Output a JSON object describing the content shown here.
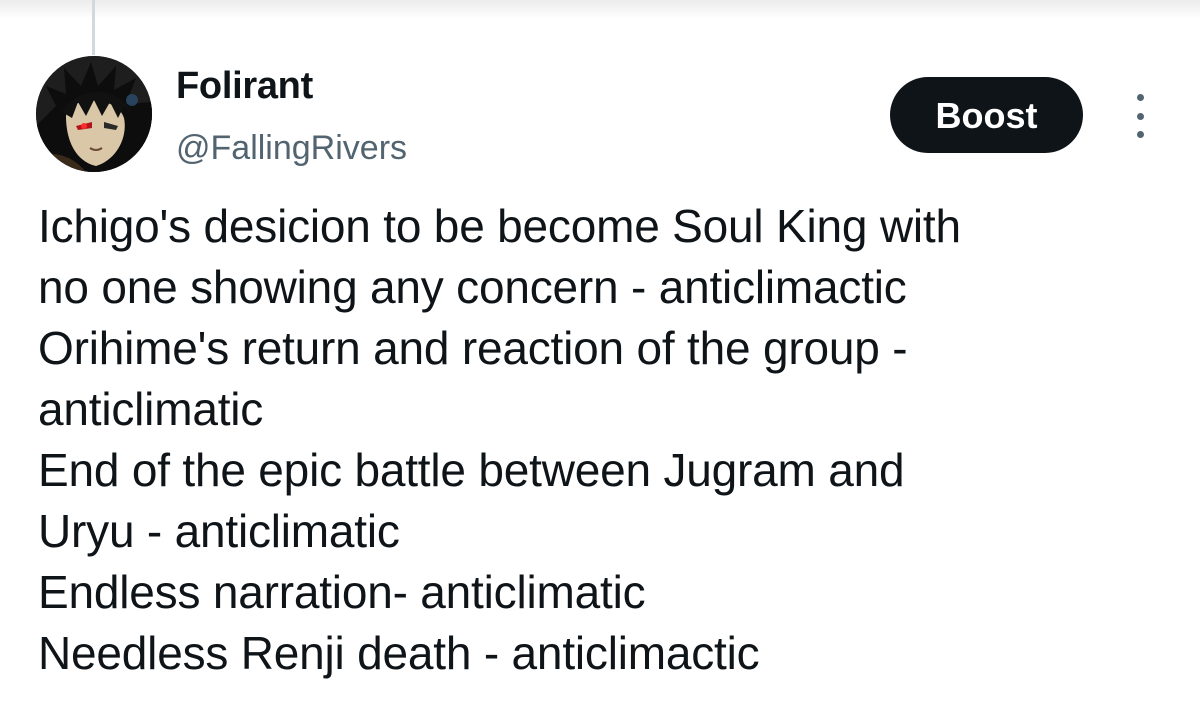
{
  "author": {
    "display_name": "Folirant",
    "handle": "@FallingRivers",
    "avatar_icon": "anime-character-avatar"
  },
  "actions": {
    "boost_label": "Boost",
    "more_icon": "vertical-ellipsis-icon"
  },
  "post": {
    "lines": [
      "Ichigo's desicion to be become Soul King with",
      "no one showing any concern - anticlimactic",
      "Orihime's return and reaction of the group -",
      "anticlimatic",
      "End of the epic battle between Jugram and",
      "Uryu - anticlimatic",
      "Endless narration- anticlimatic",
      "Needless Renji death - anticlimactic"
    ]
  },
  "colors": {
    "text_primary": "#0f1419",
    "text_secondary": "#536471",
    "button_bg": "#0f1419",
    "button_text": "#ffffff"
  }
}
